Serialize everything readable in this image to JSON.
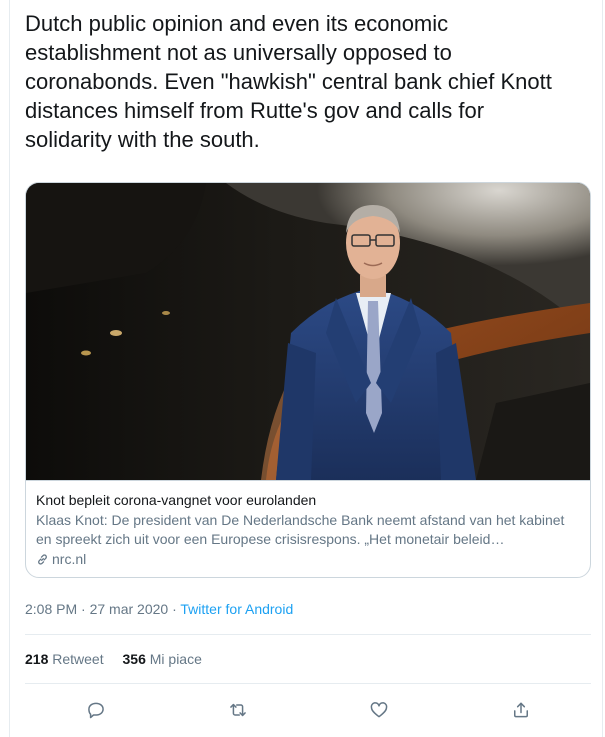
{
  "tweet": {
    "text": "Dutch public opinion and even its economic\nestablishment not as universally opposed to\ncoronabonds. Even \"hawkish\" central bank chief  Knott\ndistances himself from Rutte's gov and calls for\nsolidarity with the south."
  },
  "card": {
    "title": "Knot bepleit corona-vangnet voor eurolanden",
    "description": "Klaas Knot: De president van De Nederlandsche Bank neemt afstand van het kabinet en spreekt zich uit voor een Europese crisisrespons. „Het monetair beleid…",
    "domain": "nrc.nl",
    "domain_icon": "link-icon"
  },
  "meta": {
    "time": "2:08 PM",
    "separator": " · ",
    "date": "27 mar 2020",
    "source": "Twitter for Android"
  },
  "stats": {
    "retweets_count": "218",
    "retweets_label": "Retweet",
    "likes_count": "356",
    "likes_label": "Mi piace"
  },
  "actions": {
    "reply_icon": "reply-icon",
    "retweet_icon": "retweet-icon",
    "like_icon": "heart-icon",
    "share_icon": "share-icon"
  },
  "colors": {
    "link": "#1da1f2",
    "secondary_text": "#657786",
    "border": "#ccd6dd"
  }
}
